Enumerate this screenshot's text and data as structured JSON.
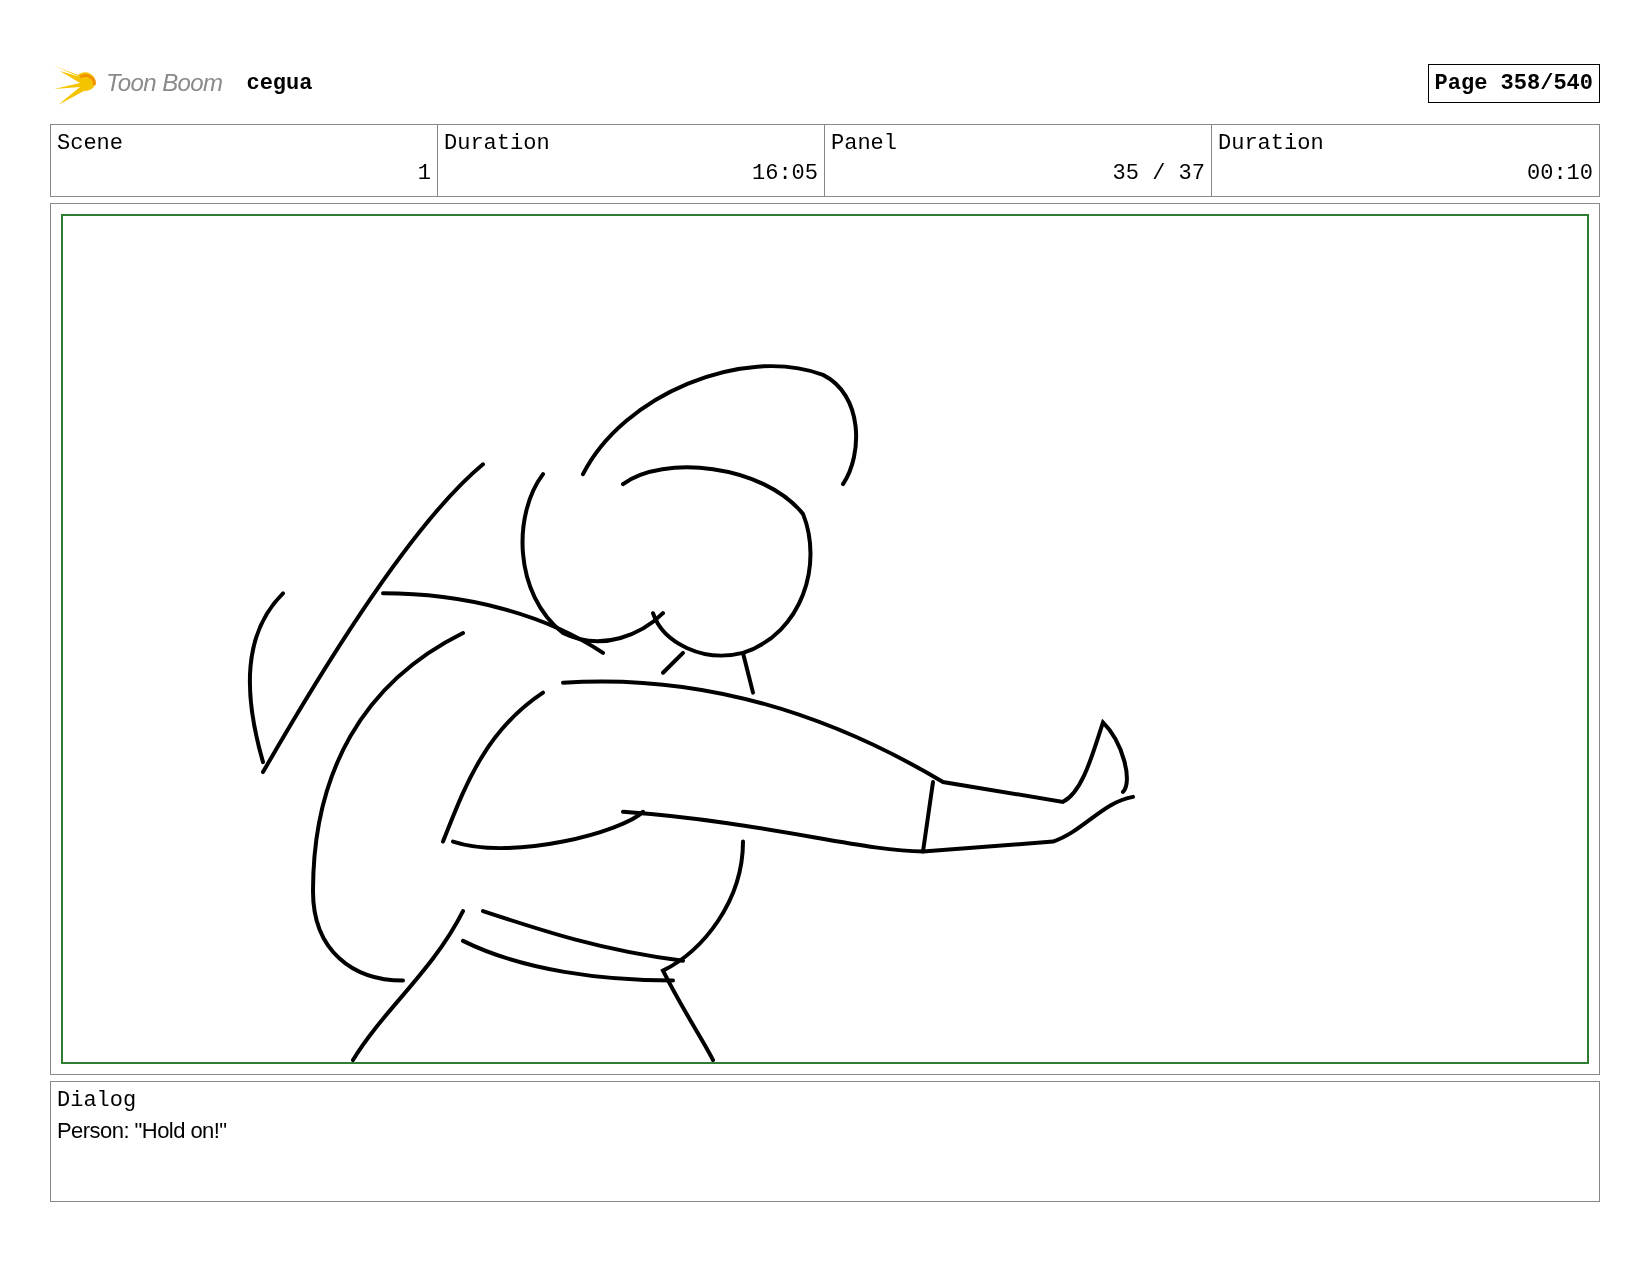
{
  "header": {
    "logo_text": "Toon Boom",
    "project": "cegua",
    "page": "Page 358/540"
  },
  "info": {
    "labels": [
      "Scene",
      "Duration",
      "Panel",
      "Duration"
    ],
    "values": [
      "1",
      "16:05",
      "35 / 37",
      "00:10"
    ]
  },
  "panel": {
    "kind": "figure"
  },
  "dialog": {
    "label": "Dialog",
    "text": "Person: \"Hold on!\""
  }
}
